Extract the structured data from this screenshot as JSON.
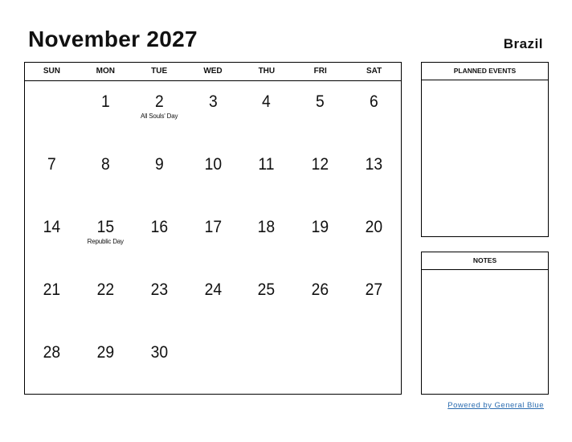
{
  "header": {
    "title": "November 2027",
    "country": "Brazil"
  },
  "weekdays": [
    "SUN",
    "MON",
    "TUE",
    "WED",
    "THU",
    "FRI",
    "SAT"
  ],
  "weeks": [
    [
      {
        "d": ""
      },
      {
        "d": "1"
      },
      {
        "d": "2",
        "h": "All Souls' Day"
      },
      {
        "d": "3"
      },
      {
        "d": "4"
      },
      {
        "d": "5"
      },
      {
        "d": "6"
      }
    ],
    [
      {
        "d": "7"
      },
      {
        "d": "8"
      },
      {
        "d": "9"
      },
      {
        "d": "10"
      },
      {
        "d": "11"
      },
      {
        "d": "12"
      },
      {
        "d": "13"
      }
    ],
    [
      {
        "d": "14"
      },
      {
        "d": "15",
        "h": "Republic Day"
      },
      {
        "d": "16"
      },
      {
        "d": "17"
      },
      {
        "d": "18"
      },
      {
        "d": "19"
      },
      {
        "d": "20"
      }
    ],
    [
      {
        "d": "21"
      },
      {
        "d": "22"
      },
      {
        "d": "23"
      },
      {
        "d": "24"
      },
      {
        "d": "25"
      },
      {
        "d": "26"
      },
      {
        "d": "27"
      }
    ],
    [
      {
        "d": "28"
      },
      {
        "d": "29"
      },
      {
        "d": "30"
      },
      {
        "d": ""
      },
      {
        "d": ""
      },
      {
        "d": ""
      },
      {
        "d": ""
      }
    ]
  ],
  "side": {
    "planned_label": "PLANNED EVENTS",
    "notes_label": "NOTES"
  },
  "footer": {
    "link_text": "Powered by General Blue"
  }
}
